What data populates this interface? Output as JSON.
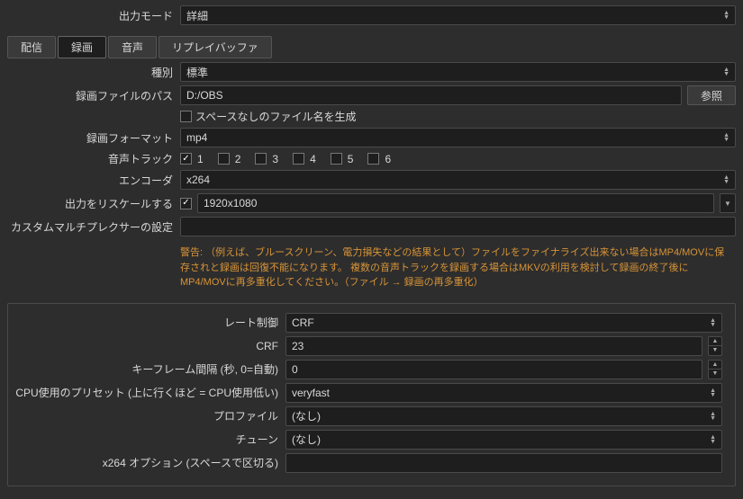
{
  "topbar": {
    "output_mode_label": "出力モード",
    "output_mode_value": "詳細"
  },
  "tabs": {
    "stream": "配信",
    "record": "録画",
    "audio": "音声",
    "replay": "リプレイバッファ"
  },
  "record": {
    "type_label": "種別",
    "type_value": "標準",
    "path_label": "録画ファイルのパス",
    "path_value": "D:/OBS",
    "browse": "参照",
    "no_space_label": "スペースなしのファイル名を生成",
    "no_space_checked": false,
    "format_label": "録画フォーマット",
    "format_value": "mp4",
    "audio_track_label": "音声トラック",
    "tracks": [
      {
        "label": "1",
        "checked": true
      },
      {
        "label": "2",
        "checked": false
      },
      {
        "label": "3",
        "checked": false
      },
      {
        "label": "4",
        "checked": false
      },
      {
        "label": "5",
        "checked": false
      },
      {
        "label": "6",
        "checked": false
      }
    ],
    "encoder_label": "エンコーダ",
    "encoder_value": "x264",
    "rescale_label": "出力をリスケールする",
    "rescale_checked": true,
    "rescale_value": "1920x1080",
    "muxer_label": "カスタムマルチプレクサーの設定",
    "muxer_value": "",
    "warning": "警告: （例えば、ブルースクリーン、電力損失などの結果として）ファイルをファイナライズ出来ない場合はMP4/MOVに保存されと録画は回復不能になります。 複数の音声トラックを録画する場合はMKVの利用を検討して録画の終了後にMP4/MOVに再多重化してください。（ファイル → 録画の再多重化）"
  },
  "encoder": {
    "rate_control_label": "レート制御",
    "rate_control_value": "CRF",
    "crf_label": "CRF",
    "crf_value": "23",
    "keyframe_label": "キーフレーム間隔 (秒, 0=自動)",
    "keyframe_value": "0",
    "preset_label": "CPU使用のプリセット (上に行くほど = CPU使用低い)",
    "preset_value": "veryfast",
    "profile_label": "プロファイル",
    "profile_value": "(なし)",
    "tune_label": "チューン",
    "tune_value": "(なし)",
    "x264opts_label": "x264 オプション (スペースで区切る)",
    "x264opts_value": ""
  }
}
